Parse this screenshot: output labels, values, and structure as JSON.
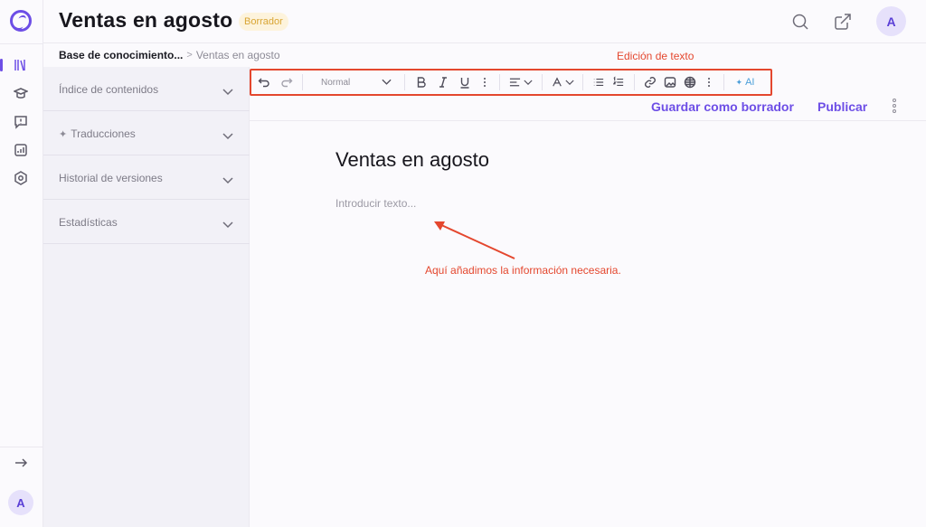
{
  "header": {
    "title": "Ventas en agosto",
    "status_badge": "Borrador",
    "avatar_initial": "A"
  },
  "breadcrumb": {
    "root": "Base de conocimiento...",
    "separator": ">",
    "current": "Ventas en agosto"
  },
  "rail": {
    "items": [
      "books-icon",
      "graduation-cap-icon",
      "feedback-icon",
      "analytics-icon",
      "settings-icon"
    ],
    "expand_icon": "arrow-right-icon",
    "avatar_initial": "A"
  },
  "panel": {
    "items": [
      {
        "label": "Índice de contenidos"
      },
      {
        "label": "Traducciones"
      },
      {
        "label": "Historial de versiones"
      },
      {
        "label": "Estadísticas"
      }
    ]
  },
  "toolbar": {
    "annotation": "Edición de texto",
    "style_value": "Normal",
    "ai_label": "AI"
  },
  "actions": {
    "save_draft": "Guardar como borrador",
    "publish": "Publicar"
  },
  "editor": {
    "doc_title": "Ventas en agosto",
    "placeholder": "Introducir texto...",
    "annotation": "Aquí añadimos la información necesaria."
  },
  "colors": {
    "accent": "#6d4ee6",
    "annotation": "#e4472e",
    "badge_text": "#d9a534",
    "badge_bg": "#fdf3dc"
  }
}
